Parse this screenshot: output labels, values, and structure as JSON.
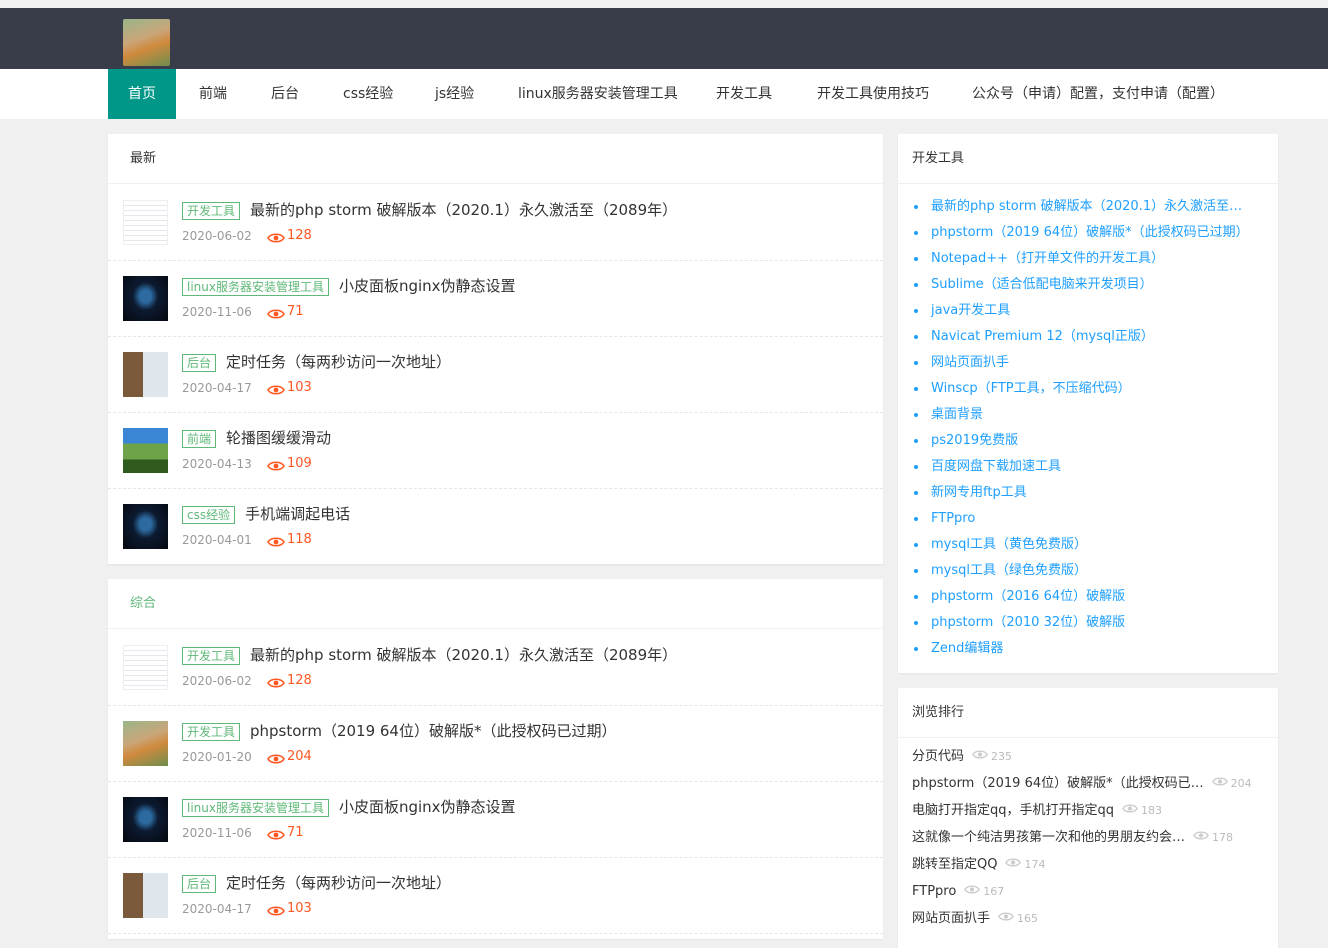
{
  "nav": [
    "首页",
    "前端",
    "后台",
    "css经验",
    "js经验",
    "linux服务器安装管理工具",
    "开发工具",
    "开发工具使用技巧",
    "公众号（申请）配置，支付申请（配置）"
  ],
  "latest": {
    "title": "最新",
    "items": [
      {
        "tag": "开发工具",
        "title": "最新的php storm 破解版本（2020.1）永久激活至（2089年）",
        "date": "2020-06-02",
        "views": "128",
        "thumb": "doc"
      },
      {
        "tag": "linux服务器安装管理工具",
        "title": "小皮面板nginx伪静态设置",
        "date": "2020-11-06",
        "views": "71",
        "thumb": "phone"
      },
      {
        "tag": "后台",
        "title": "定时任务（每两秒访问一次地址）",
        "date": "2020-04-17",
        "views": "103",
        "thumb": "people"
      },
      {
        "tag": "前端",
        "title": "轮播图缓缓滑动",
        "date": "2020-04-13",
        "views": "109",
        "thumb": "landscape"
      },
      {
        "tag": "css经验",
        "title": "手机端调起电话",
        "date": "2020-04-01",
        "views": "118",
        "thumb": "phone"
      }
    ]
  },
  "mixed": {
    "title": "综合",
    "items": [
      {
        "tag": "开发工具",
        "title": "最新的php storm 破解版本（2020.1）永久激活至（2089年）",
        "date": "2020-06-02",
        "views": "128",
        "thumb": "doc"
      },
      {
        "tag": "开发工具",
        "title": "phpstorm（2019 64位）破解版*（此授权码已过期）",
        "date": "2020-01-20",
        "views": "204",
        "thumb": "dog"
      },
      {
        "tag": "linux服务器安装管理工具",
        "title": "小皮面板nginx伪静态设置",
        "date": "2020-11-06",
        "views": "71",
        "thumb": "phone"
      },
      {
        "tag": "后台",
        "title": "定时任务（每两秒访问一次地址）",
        "date": "2020-04-17",
        "views": "103",
        "thumb": "people"
      }
    ]
  },
  "devtools": {
    "title": "开发工具",
    "items": [
      "最新的php storm 破解版本（2020.1）永久激活至…",
      "phpstorm（2019 64位）破解版*（此授权码已过期）",
      "Notepad++（打开单文件的开发工具）",
      "Sublime（适合低配电脑来开发项目）",
      "java开发工具",
      "Navicat Premium 12（mysql正版）",
      "网站页面扒手",
      "Winscp（FTP工具，不压缩代码）",
      "桌面背景",
      "ps2019免费版",
      "百度网盘下载加速工具",
      "新网专用ftp工具",
      "FTPpro",
      "mysql工具（黄色免费版）",
      "mysql工具（绿色免费版）",
      "phpstorm（2016 64位）破解版",
      "phpstorm（2010 32位）破解版",
      "Zend编辑器"
    ]
  },
  "ranking": {
    "title": "浏览排行",
    "items": [
      {
        "title": "分页代码",
        "views": "235"
      },
      {
        "title": "phpstorm（2019 64位）破解版*（此授权码已…",
        "views": "204"
      },
      {
        "title": "电脑打开指定qq，手机打开指定qq",
        "views": "183"
      },
      {
        "title": "这就像一个纯洁男孩第一次和他的男朋友约会…",
        "views": "178"
      },
      {
        "title": "跳转至指定QQ",
        "views": "174"
      },
      {
        "title": "FTPpro",
        "views": "167"
      },
      {
        "title": "网站页面扒手",
        "views": "165"
      }
    ]
  },
  "colors": {
    "header": "#393d49",
    "active_nav": "#009688",
    "tag": "#5fb878",
    "views": "#ff5722",
    "link": "#1e9fff"
  }
}
